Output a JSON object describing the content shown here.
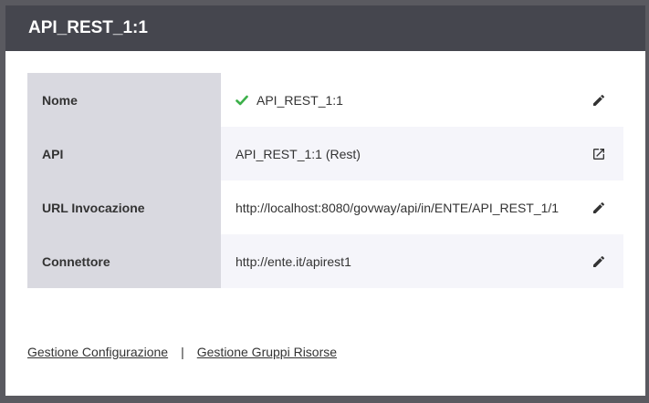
{
  "dialog": {
    "title": "API_REST_1:1"
  },
  "rows": [
    {
      "label": "Nome",
      "value": "API_REST_1:1",
      "status_color": "#3cb04a",
      "action_icon": "pencil-icon"
    },
    {
      "label": "API",
      "value": "API_REST_1:1 (Rest)",
      "action_icon": "open-external-icon"
    },
    {
      "label": "URL Invocazione",
      "value": "http://localhost:8080/govway/api/in/ENTE/API_REST_1/1",
      "action_icon": "pencil-icon"
    },
    {
      "label": "Connettore",
      "value": "http://ente.it/apirest1",
      "action_icon": "pencil-icon"
    }
  ],
  "footer": {
    "link1": "Gestione Configurazione",
    "separator": "|",
    "link2": "Gestione Gruppi Risorse"
  }
}
